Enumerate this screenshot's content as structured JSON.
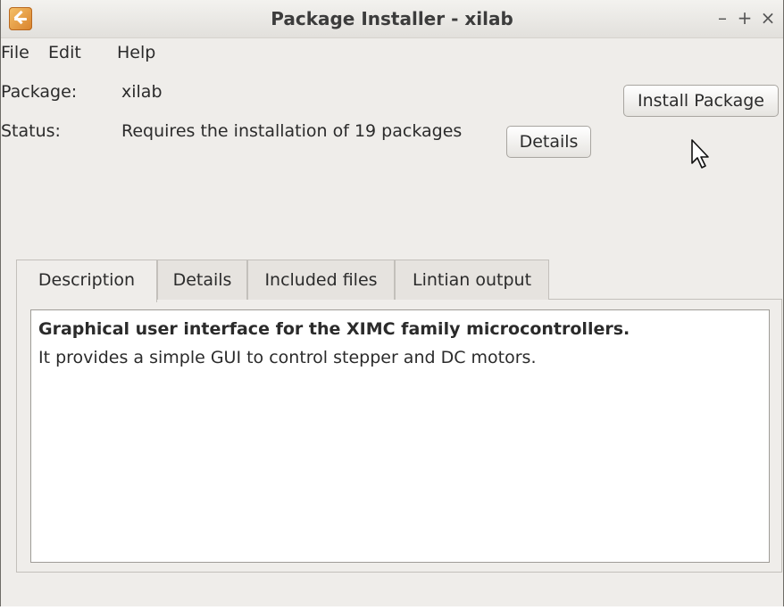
{
  "window": {
    "title": "Package Installer - xilab",
    "controls": {
      "minimize": "–",
      "maximize": "+",
      "close": "×"
    }
  },
  "menu": [
    "File",
    "Edit",
    "Help"
  ],
  "package": {
    "label": "Package:",
    "value": "xilab"
  },
  "status": {
    "label": "Status:",
    "value": "Requires the installation of 19 packages"
  },
  "buttons": {
    "details": "Details",
    "install": "Install Package"
  },
  "tabs": [
    "Description",
    "Details",
    "Included files",
    "Lintian output"
  ],
  "active_tab": "Description",
  "description": {
    "title": "Graphical user interface for the XIMC family microcontrollers.",
    "body": "It provides a simple GUI to control stepper and DC motors."
  }
}
